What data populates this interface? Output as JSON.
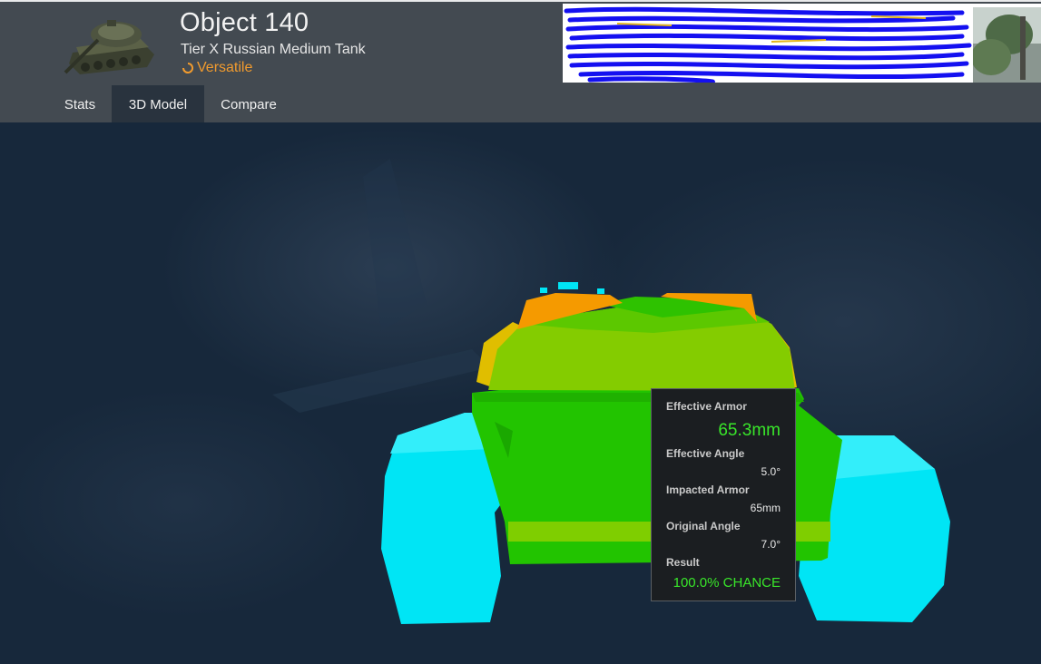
{
  "header": {
    "tank_name": "Object 140",
    "subtitle": "Tier X Russian Medium Tank",
    "role": "Versatile",
    "role_icon": "versatile-icon",
    "role_color": "#f19b2e"
  },
  "tabs": [
    {
      "label": "Stats",
      "active": false
    },
    {
      "label": "3D Model",
      "active": true
    },
    {
      "label": "Compare",
      "active": false
    }
  ],
  "armor_tooltip": {
    "effective_armor_label": "Effective Armor",
    "effective_armor_value": "65.3mm",
    "effective_angle_label": "Effective Angle",
    "effective_angle_value": "5.0°",
    "impacted_armor_label": "Impacted Armor",
    "impacted_armor_value": "65mm",
    "original_angle_label": "Original Angle",
    "original_angle_value": "7.0°",
    "result_label": "Result",
    "result_value": "100.0% CHANCE",
    "highlight_color": "#39e62a"
  },
  "armor_colors": {
    "tracks": "#00e5f5",
    "hull_green": "#22c400",
    "turret_green": "#84cc00",
    "turret_yellow": "#e0be00",
    "turret_orange": "#f59a00"
  }
}
